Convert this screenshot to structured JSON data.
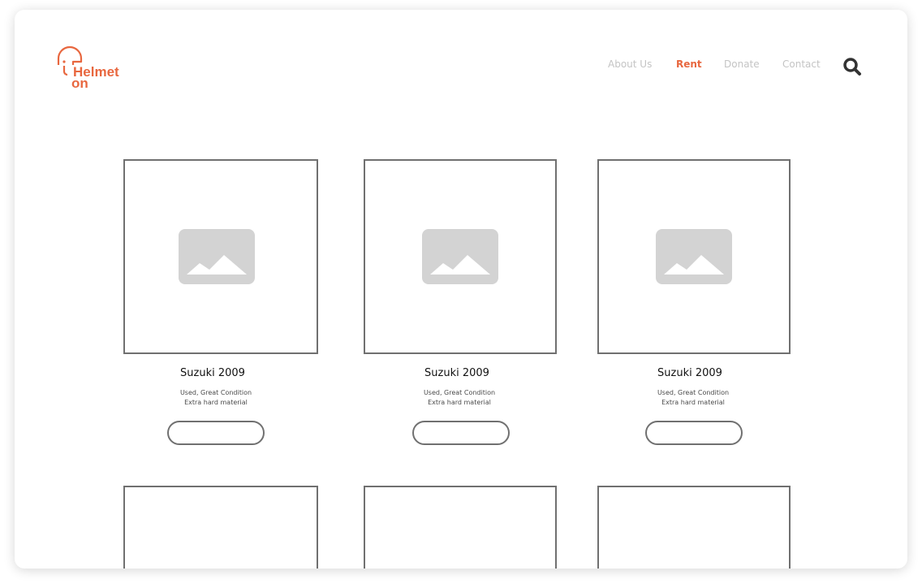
{
  "brand": {
    "line1": "Helmet",
    "line2": "on",
    "color": "#e8673f"
  },
  "nav": {
    "items": [
      {
        "label": "About Us",
        "active": false
      },
      {
        "label": "Rent",
        "active": true
      },
      {
        "label": "Donate",
        "active": false
      },
      {
        "label": "Contact",
        "active": false
      }
    ],
    "search_icon": "search-icon"
  },
  "products": [
    {
      "title": "Suzuki 2009",
      "desc_line1": "Used, Great Condition",
      "desc_line2": "Extra hard material",
      "image_icon": "image-placeholder-icon",
      "button_label": ""
    },
    {
      "title": "Suzuki 2009",
      "desc_line1": "Used, Great Condition",
      "desc_line2": "Extra hard material",
      "image_icon": "image-placeholder-icon",
      "button_label": ""
    },
    {
      "title": "Suzuki 2009",
      "desc_line1": "Used, Great Condition",
      "desc_line2": "Extra hard material",
      "image_icon": "image-placeholder-icon",
      "button_label": ""
    }
  ],
  "colors": {
    "accent": "#e8673f",
    "nav_inactive": "#c4c4c4",
    "border": "#707070",
    "placeholder": "#d3d3d3"
  }
}
